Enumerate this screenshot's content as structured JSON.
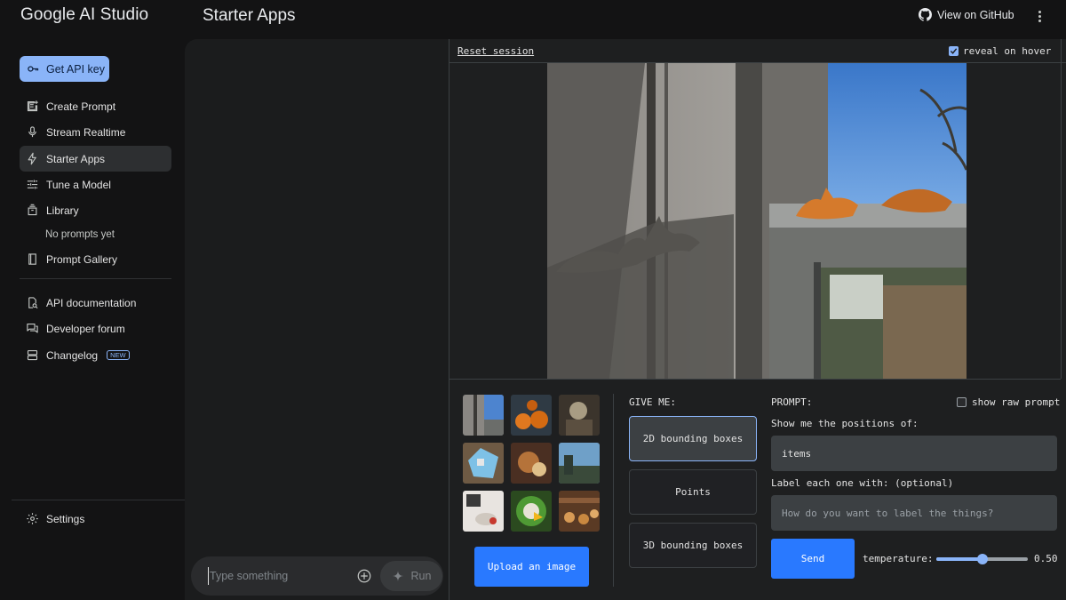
{
  "header": {
    "logo": "Google AI Studio",
    "page_title": "Starter Apps",
    "github_label": "View on GitHub"
  },
  "sidebar": {
    "api_key_label": "Get API key",
    "items": [
      {
        "label": "Create Prompt",
        "icon": "create-prompt-icon"
      },
      {
        "label": "Stream Realtime",
        "icon": "microphone-icon"
      },
      {
        "label": "Starter Apps",
        "icon": "bolt-icon",
        "active": true
      },
      {
        "label": "Tune a Model",
        "icon": "tune-icon"
      },
      {
        "label": "Library",
        "icon": "library-icon"
      },
      {
        "label": "Prompt Gallery",
        "icon": "book-icon"
      }
    ],
    "library_empty": "No prompts yet",
    "resources": [
      {
        "label": "API documentation",
        "icon": "api-doc-icon"
      },
      {
        "label": "Developer forum",
        "icon": "forum-icon"
      },
      {
        "label": "Changelog",
        "icon": "changelog-icon",
        "badge": "NEW"
      }
    ],
    "settings_label": "Settings"
  },
  "chat": {
    "input_placeholder": "Type something",
    "run_label": "Run"
  },
  "app": {
    "reset_label": "Reset session",
    "reveal_label": "reveal on hover",
    "reveal_checked": true,
    "upload_label": "Upload an image",
    "give_me_label": "GIVE ME:",
    "give_options": [
      "2D bounding boxes",
      "Points",
      "3D bounding boxes"
    ],
    "give_selected": "2D bounding boxes",
    "prompt_label": "PROMPT:",
    "show_raw_label": "show raw prompt",
    "show_raw_checked": false,
    "positions_label": "Show me the positions of:",
    "positions_value": "items",
    "label_label": "Label each one with: (optional)",
    "label_placeholder": "How do you want to label the things?",
    "send_label": "Send",
    "temperature_label": "temperature:",
    "temperature_value": "0.50",
    "temperature_fraction": 0.5
  },
  "colors": {
    "accent": "#8ab4f8",
    "button_blue": "#2979ff",
    "background": "#131314"
  }
}
